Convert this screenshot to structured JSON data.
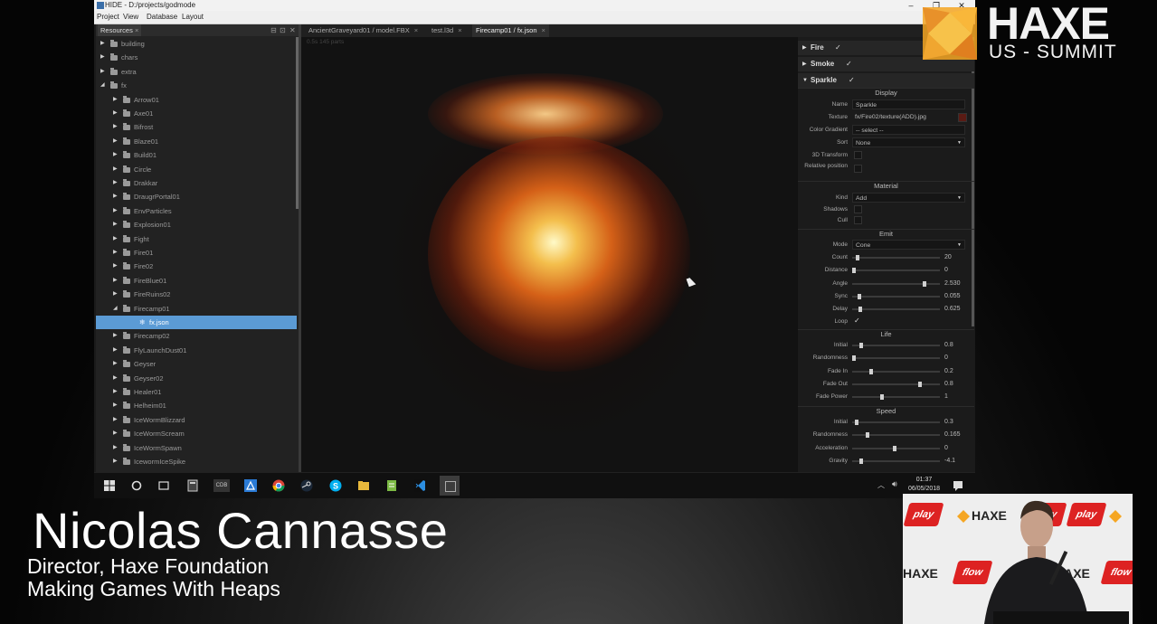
{
  "window": {
    "title": "HIDE - D:/projects/godmode",
    "controls": [
      "–",
      "❐",
      "✕"
    ]
  },
  "menu": [
    "Project",
    "View",
    "Database",
    "Layout"
  ],
  "resources_panel": {
    "tab_label": "Resources",
    "tree": [
      {
        "label": "building",
        "depth": 0,
        "type": "folder",
        "expanded": false
      },
      {
        "label": "chars",
        "depth": 0,
        "type": "folder",
        "expanded": false
      },
      {
        "label": "extra",
        "depth": 0,
        "type": "folder",
        "expanded": false
      },
      {
        "label": "fx",
        "depth": 0,
        "type": "folder",
        "expanded": true
      },
      {
        "label": "Arrow01",
        "depth": 1,
        "type": "folder",
        "expanded": false
      },
      {
        "label": "Axe01",
        "depth": 1,
        "type": "folder",
        "expanded": false
      },
      {
        "label": "Bifrost",
        "depth": 1,
        "type": "folder",
        "expanded": false
      },
      {
        "label": "Blaze01",
        "depth": 1,
        "type": "folder",
        "expanded": false
      },
      {
        "label": "Build01",
        "depth": 1,
        "type": "folder",
        "expanded": false
      },
      {
        "label": "Circle",
        "depth": 1,
        "type": "folder",
        "expanded": false
      },
      {
        "label": "Drakkar",
        "depth": 1,
        "type": "folder",
        "expanded": false
      },
      {
        "label": "DraugrPortal01",
        "depth": 1,
        "type": "folder",
        "expanded": false
      },
      {
        "label": "EnvParticles",
        "depth": 1,
        "type": "folder",
        "expanded": false
      },
      {
        "label": "Explosion01",
        "depth": 1,
        "type": "folder",
        "expanded": false
      },
      {
        "label": "Fight",
        "depth": 1,
        "type": "folder",
        "expanded": false
      },
      {
        "label": "Fire01",
        "depth": 1,
        "type": "folder",
        "expanded": false
      },
      {
        "label": "Fire02",
        "depth": 1,
        "type": "folder",
        "expanded": false
      },
      {
        "label": "FireBlue01",
        "depth": 1,
        "type": "folder",
        "expanded": false
      },
      {
        "label": "FireRuins02",
        "depth": 1,
        "type": "folder",
        "expanded": false
      },
      {
        "label": "Firecamp01",
        "depth": 1,
        "type": "folder",
        "expanded": true
      },
      {
        "label": "fx.json",
        "depth": 2,
        "type": "file",
        "selected": true
      },
      {
        "label": "Firecamp02",
        "depth": 1,
        "type": "folder",
        "expanded": false
      },
      {
        "label": "FlyLaunchDust01",
        "depth": 1,
        "type": "folder",
        "expanded": false
      },
      {
        "label": "Geyser",
        "depth": 1,
        "type": "folder",
        "expanded": false
      },
      {
        "label": "Geyser02",
        "depth": 1,
        "type": "folder",
        "expanded": false
      },
      {
        "label": "Healer01",
        "depth": 1,
        "type": "folder",
        "expanded": false
      },
      {
        "label": "Helheim01",
        "depth": 1,
        "type": "folder",
        "expanded": false
      },
      {
        "label": "IceWormBlizzard",
        "depth": 1,
        "type": "folder",
        "expanded": false
      },
      {
        "label": "IceWormScream",
        "depth": 1,
        "type": "folder",
        "expanded": false
      },
      {
        "label": "IceWormSpawn",
        "depth": 1,
        "type": "folder",
        "expanded": false
      },
      {
        "label": "IcewormIceSpike",
        "depth": 1,
        "type": "folder",
        "expanded": false
      }
    ]
  },
  "doc_tabs": [
    {
      "label": "AncientGraveyard01 / model.FBX",
      "active": false
    },
    {
      "label": "test.l3d",
      "active": false
    },
    {
      "label": "Firecamp01 / fx.json",
      "active": true
    }
  ],
  "viewport": {
    "info": "0.5s 145 parts"
  },
  "properties": {
    "fire": {
      "label": "Fire",
      "check": "✓"
    },
    "smoke": {
      "label": "Smoke",
      "check": "✓"
    },
    "sparkle": {
      "label": "Sparkle",
      "check": "✓"
    },
    "display_header": "Display",
    "name_label": "Name",
    "name_value": "Sparkle",
    "texture_label": "Texture",
    "texture_value": "fx/Fire02/texture(ADD).jpg",
    "gradient_label": "Color Gradient",
    "gradient_value": "-- select --",
    "sort_label": "Sort",
    "sort_value": "None",
    "transform_label": "3D Transform",
    "relpos_label": "Relative position",
    "material_header": "Material",
    "kind_label": "Kind",
    "kind_value": "Add",
    "shadows_label": "Shadows",
    "cull_label": "Cull",
    "emit_header": "Emit",
    "mode_label": "Mode",
    "mode_value": "Cone",
    "emit": [
      {
        "label": "Count",
        "value": "20",
        "pos": 0.04
      },
      {
        "label": "Distance",
        "value": "0",
        "pos": 0.0
      },
      {
        "label": "Angle",
        "value": "2.530",
        "pos": 0.84
      },
      {
        "label": "Sync",
        "value": "0.055",
        "pos": 0.06
      },
      {
        "label": "Delay",
        "value": "0.625",
        "pos": 0.08
      }
    ],
    "loop_label": "Loop",
    "loop_check": "✓",
    "life_header": "Life",
    "life": [
      {
        "label": "Initial",
        "value": "0.8",
        "pos": 0.09
      },
      {
        "label": "Randomness",
        "value": "0",
        "pos": 0.0
      },
      {
        "label": "Fade In",
        "value": "0.2",
        "pos": 0.2
      },
      {
        "label": "Fade Out",
        "value": "0.8",
        "pos": 0.78
      },
      {
        "label": "Fade Power",
        "value": "1",
        "pos": 0.33
      }
    ],
    "speed_header": "Speed",
    "speed": [
      {
        "label": "Initial",
        "value": "0.3",
        "pos": 0.03
      },
      {
        "label": "Randomness",
        "value": "0.165",
        "pos": 0.16
      },
      {
        "label": "Acceleration",
        "value": "0",
        "pos": 0.48
      },
      {
        "label": "Gravity",
        "value": "-4.1",
        "pos": 0.09
      }
    ]
  },
  "taskbar": {
    "time": "01:37",
    "date": "06/05/2018",
    "cdb_label": "CDB",
    "icons": [
      "windows-start-icon",
      "cortana-icon",
      "task-view-icon",
      "calculator-icon",
      "cdb-icon",
      "app-icon",
      "chrome-icon",
      "steam-icon",
      "skype-icon",
      "explorer-icon",
      "notepad-icon",
      "vscode-icon",
      "window-icon"
    ]
  },
  "overlay": {
    "logo_big": "HAXE",
    "logo_small": "US - SUMMIT",
    "speaker_name": "Nicolas Cannasse",
    "speaker_role": "Director, Haxe Foundation",
    "talk_title": "Making Games With Heaps",
    "pip_haxe": "HAXE",
    "pip_playbrand": "play",
    "pip_flowbrand": "flow"
  },
  "colors": {
    "selection": "#5b9bd5",
    "haxe_orange": "#f5a623",
    "brand_red": "#dd2222"
  }
}
